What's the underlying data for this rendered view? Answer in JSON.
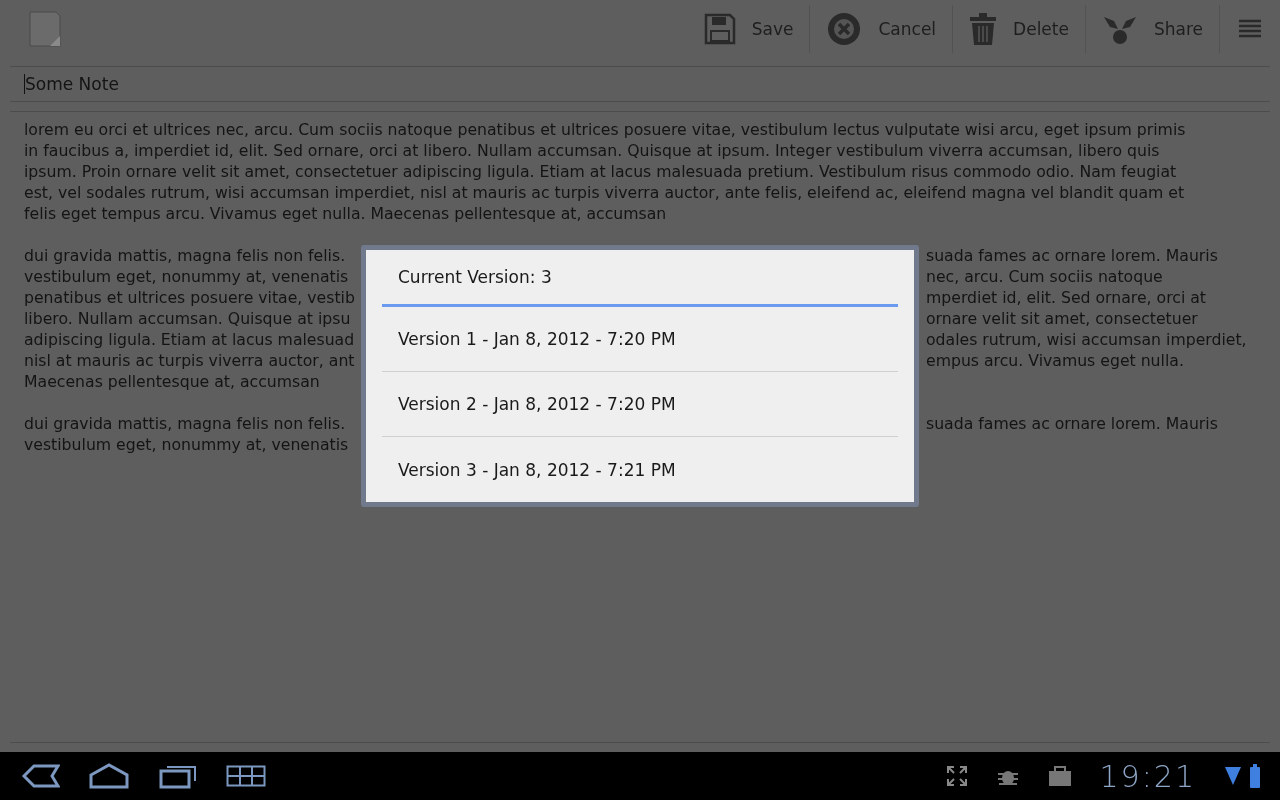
{
  "action_bar": {
    "actions": [
      {
        "kind": "save",
        "label": "Save"
      },
      {
        "kind": "cancel",
        "label": "Cancel"
      },
      {
        "kind": "delete",
        "label": "Delete"
      },
      {
        "kind": "share",
        "label": "Share"
      }
    ]
  },
  "note": {
    "title": "Some Note",
    "paragraphs": [
      {
        "kind": "full",
        "lines": [
          "lorem eu orci et ultrices nec, arcu. Cum sociis natoque penatibus et ultrices posuere vitae, vestibulum lectus vulputate wisi arcu, eget ipsum primis",
          "in faucibus a, imperdiet id, elit. Sed ornare, orci at libero. Nullam accumsan. Quisque at ipsum. Integer vestibulum viverra accumsan, libero quis",
          "ipsum. Proin ornare velit sit amet, consectetuer adipiscing ligula. Etiam at lacus malesuada pretium. Vestibulum risus commodo odio. Nam feugiat",
          "est, vel sodales rutrum, wisi accumsan imperdiet, nisl at mauris ac turpis viverra auctor, ante felis, eleifend ac, eleifend magna vel blandit quam et",
          "felis eget tempus arcu. Vivamus eget nulla. Maecenas pellentesque at, accumsan"
        ]
      },
      {
        "kind": "covered",
        "lines": [
          {
            "left": "dui gravida mattis, magna felis non felis.",
            "right": "suada fames ac ornare lorem. Mauris"
          },
          {
            "left": "vestibulum eget, nonummy at, venenatis",
            "right": "nec, arcu. Cum sociis natoque"
          },
          {
            "left": "penatibus et ultrices posuere vitae, vestib",
            "right": "mperdiet id, elit. Sed ornare, orci at"
          },
          {
            "left": "libero. Nullam accumsan. Quisque at ipsu",
            "right": "ornare velit sit amet, consectetuer"
          },
          {
            "left": "adipiscing ligula. Etiam at lacus malesuad",
            "right": "odales rutrum, wisi accumsan imperdiet,"
          },
          {
            "left": "nisl at mauris ac turpis viverra auctor, ant",
            "right": "empus arcu. Vivamus eget nulla."
          },
          {
            "left": "Maecenas pellentesque at, accumsan"
          }
        ]
      },
      {
        "kind": "covered",
        "lines": [
          {
            "left": "dui gravida mattis, magna felis non felis.",
            "right": "suada fames ac ornare lorem. Mauris"
          },
          {
            "left": "vestibulum eget, nonummy at, venenatis"
          }
        ]
      }
    ]
  },
  "dialog": {
    "title": "Current Version: 3",
    "items": [
      {
        "label": "Version 1 - Jan 8, 2012 - 7:20 PM"
      },
      {
        "label": "Version 2 - Jan 8, 2012 - 7:20 PM"
      },
      {
        "label": "Version 3 - Jan 8, 2012 - 7:21 PM"
      }
    ]
  },
  "system_bar": {
    "time": "19:21"
  }
}
